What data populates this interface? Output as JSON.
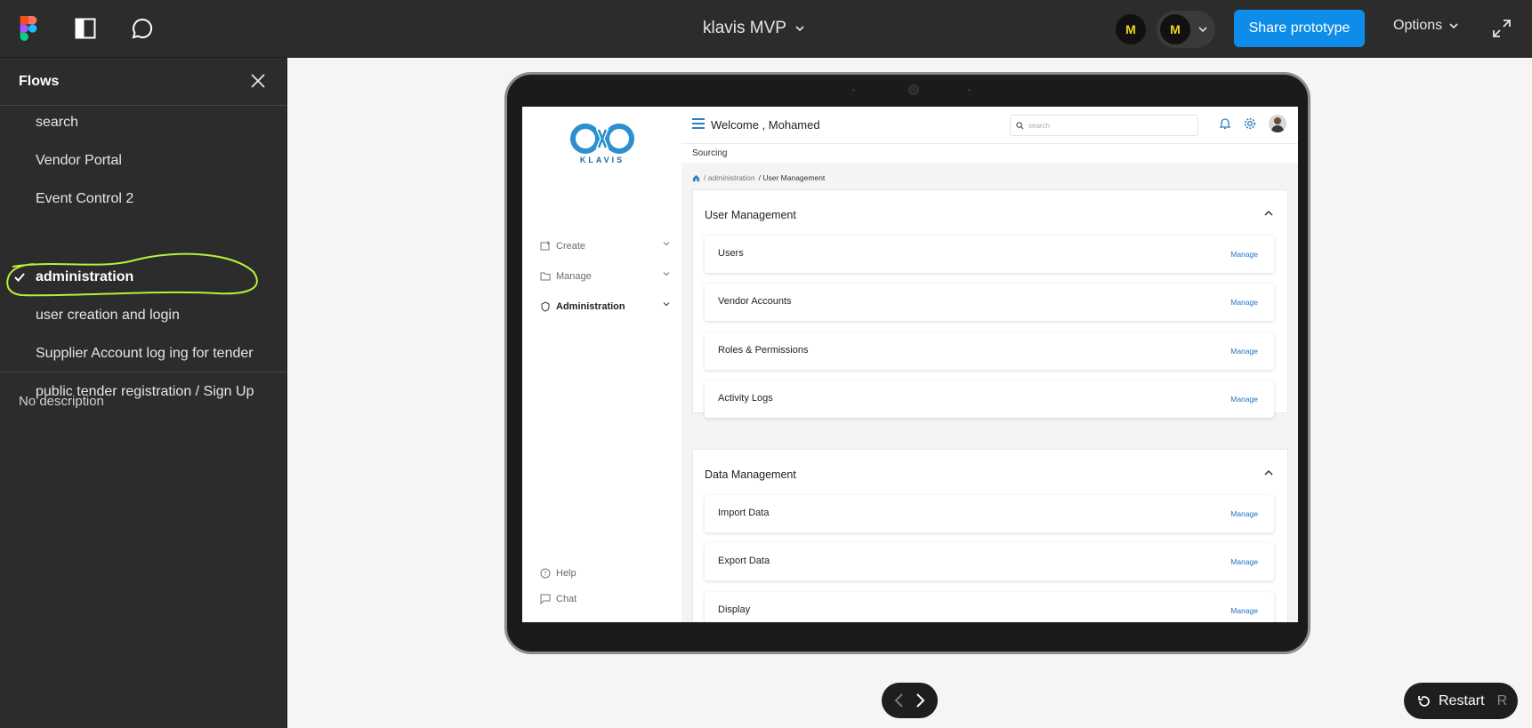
{
  "topbar": {
    "document_title": "klavis MVP",
    "share_label": "Share prototype",
    "options_label": "Options",
    "avatar_letter": "M",
    "brand_color": "#0d8ce9",
    "avatar_color": "#f5d416"
  },
  "flows": {
    "title": "Flows",
    "items": [
      {
        "label": "search",
        "active": false
      },
      {
        "label": "Vendor Portal",
        "active": false
      },
      {
        "label": "Event Control 2",
        "active": false
      },
      {
        "label": "administration",
        "active": true
      },
      {
        "label": "user creation and login",
        "active": false
      },
      {
        "label": "Supplier Account log ing for tender",
        "active": false
      },
      {
        "label": "public tender registration / Sign Up",
        "active": false
      }
    ],
    "description": "No description",
    "highlight_color": "#b6f03a"
  },
  "app": {
    "logo_text": "KLAVIS",
    "welcome": "Welcome , Mohamed",
    "search_placeholder": "search",
    "sourcing": "Sourcing",
    "breadcrumb": {
      "parent": "/ administration",
      "current": "/ User Management"
    },
    "sidebar": [
      {
        "label": "Create",
        "icon": "create-icon"
      },
      {
        "label": "Manage",
        "icon": "manage-folder-icon"
      },
      {
        "label": "Administration",
        "icon": "administration-icon"
      }
    ],
    "help": "Help",
    "chat": "Chat",
    "sections": [
      {
        "title": "User Management",
        "rows": [
          {
            "label": "Users",
            "action": "Manage"
          },
          {
            "label": "Vendor Accounts",
            "action": "Manage"
          },
          {
            "label": "Roles & Permissions",
            "action": "Manage"
          },
          {
            "label": "Activity Logs",
            "action": "Manage"
          }
        ]
      },
      {
        "title": "Data Management",
        "rows": [
          {
            "label": "Import Data",
            "action": "Manage"
          },
          {
            "label": "Export Data",
            "action": "Manage"
          },
          {
            "label": "Display",
            "action": "Manage"
          }
        ]
      }
    ],
    "accent_color": "#1f73c7"
  },
  "footer": {
    "restart_label": "Restart",
    "restart_key": "R"
  }
}
